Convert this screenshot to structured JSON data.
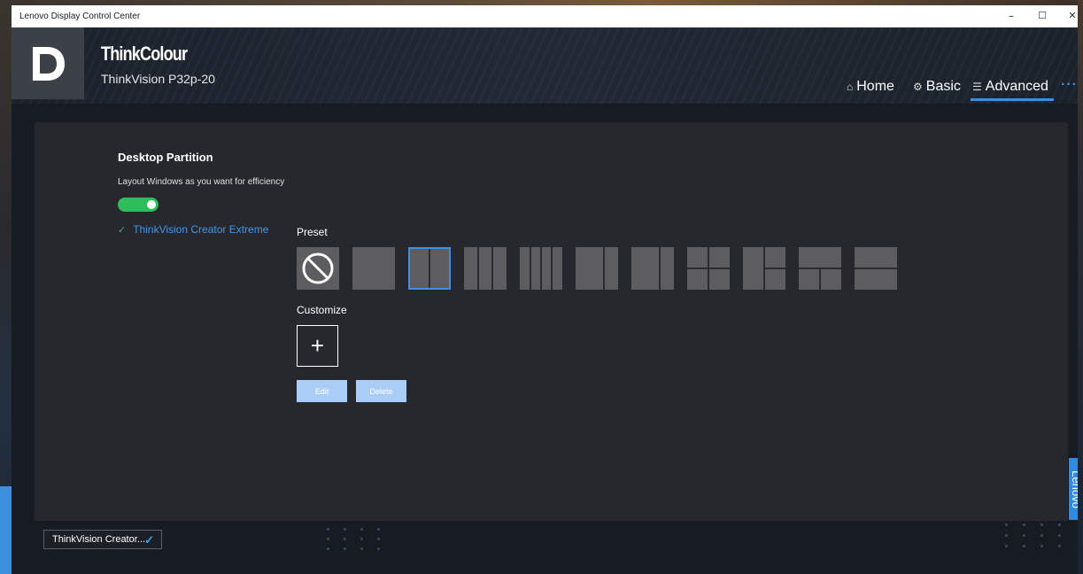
{
  "window": {
    "title": "Lenovo Display Control Center",
    "minimize": "–",
    "maximize": "☐",
    "close": "✕"
  },
  "header": {
    "logo_letter": "D",
    "brand": "ThinkColour",
    "model": "ThinkVision P32p-20",
    "nav": [
      {
        "label": "Home",
        "icon": "home-icon",
        "glyph": "⌂"
      },
      {
        "label": "Basic",
        "icon": "gear-icon",
        "glyph": "⚙"
      },
      {
        "label": "Advanced",
        "icon": "sliders-icon",
        "glyph": "☰",
        "active": true
      }
    ],
    "more": "···"
  },
  "partition": {
    "title": "Desktop Partition",
    "subtitle": "Layout Windows as you want for efficiency",
    "enabled": true,
    "device": "ThinkVision Creator Extreme",
    "preset_label": "Preset",
    "customize_label": "Customize",
    "selected_preset_index": 2,
    "edit_label": "Edit",
    "delete_label": "Delete"
  },
  "bottom": {
    "device_select": "ThinkVision Creator..."
  },
  "side_tab": "Lenovo",
  "colors": {
    "accent": "#3d8fe8",
    "toggle_on": "#2ebd5a",
    "panel": "#26282d"
  }
}
